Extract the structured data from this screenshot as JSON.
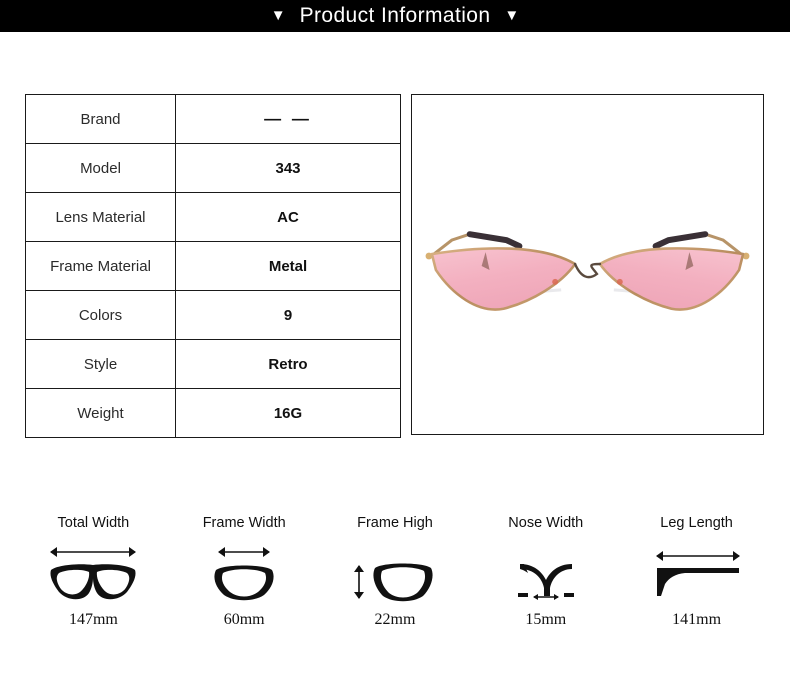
{
  "header": {
    "left_caret": "▼",
    "title": "Product Information",
    "right_caret": "▼",
    "background_color": "#000000",
    "text_color": "#ffffff"
  },
  "spec_table": {
    "rows": [
      {
        "label": "Brand",
        "value": "— —"
      },
      {
        "label": "Model",
        "value": "343"
      },
      {
        "label": "Lens Material",
        "value": "AC"
      },
      {
        "label": "Frame Material",
        "value": "Metal"
      },
      {
        "label": "Colors",
        "value": "9"
      },
      {
        "label": "Style",
        "value": "Retro"
      },
      {
        "label": "Weight",
        "value": "16G"
      }
    ]
  },
  "product_image": {
    "alt": "cat-eye sunglasses with pink triangular lenses and gold metal frame",
    "lens_color": "#f3b2c0",
    "frame_color": "#c79a6d",
    "temple_color": "#3a3036",
    "background_color": "#ffffff"
  },
  "measurements": [
    {
      "label": "Total Width",
      "value": "147mm",
      "icon": "full-glasses-icon"
    },
    {
      "label": "Frame Width",
      "value": "60mm",
      "icon": "single-lens-width-icon"
    },
    {
      "label": "Frame High",
      "value": "22mm",
      "icon": "single-lens-height-icon"
    },
    {
      "label": "Nose Width",
      "value": "15mm",
      "icon": "nose-bridge-icon"
    },
    {
      "label": "Leg Length",
      "value": "141mm",
      "icon": "temple-arm-icon"
    }
  ]
}
